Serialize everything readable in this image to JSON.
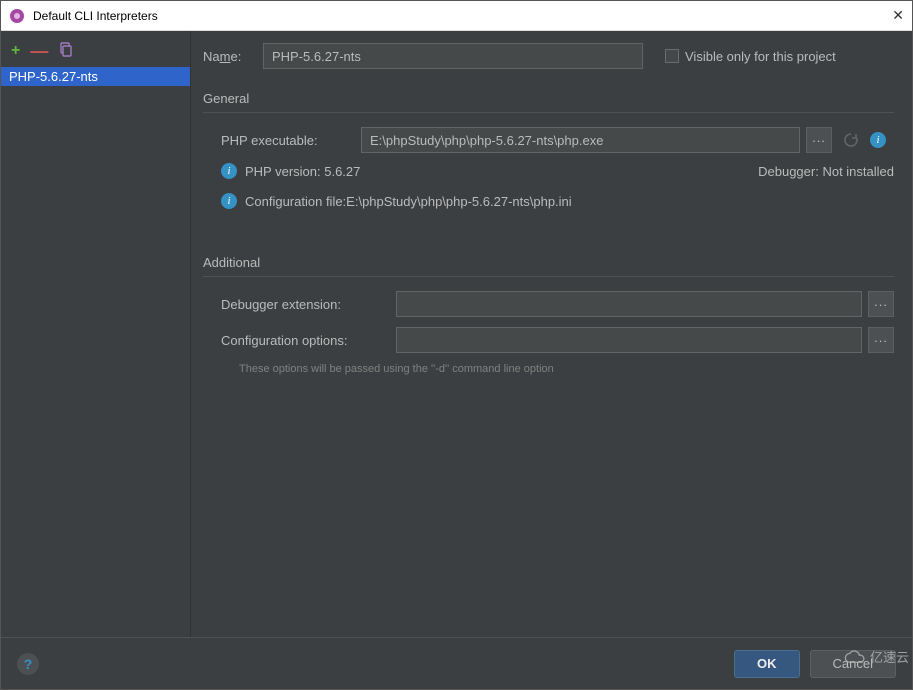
{
  "window": {
    "title": "Default CLI Interpreters"
  },
  "sidebar": {
    "items": [
      {
        "label": "PHP-5.6.27-nts"
      }
    ]
  },
  "form": {
    "name_label": "Name:",
    "name_label_prefix": "Na",
    "name_label_u": "m",
    "name_label_suffix": "e:",
    "name_value": "PHP-5.6.27-nts",
    "visible_only_label": "Visible only for this project"
  },
  "general": {
    "title": "General",
    "php_exec_label": "PHP executable:",
    "php_exec_value": "E:\\phpStudy\\php\\php-5.6.27-nts\\php.exe",
    "php_version_label": "PHP version: 5.6.27",
    "debugger_label": "Debugger:",
    "debugger_value": "Not installed",
    "config_file_label": "Configuration file:",
    "config_file_value": "E:\\phpStudy\\php\\php-5.6.27-nts\\php.ini"
  },
  "additional": {
    "title": "Additional",
    "debugger_ext_label": "Debugger extension:",
    "config_options_label": "Configuration options:",
    "hint": "These options will be passed using the ''-d'' command line option"
  },
  "footer": {
    "ok": "OK",
    "cancel": "Cancel"
  },
  "watermark": "亿速云"
}
